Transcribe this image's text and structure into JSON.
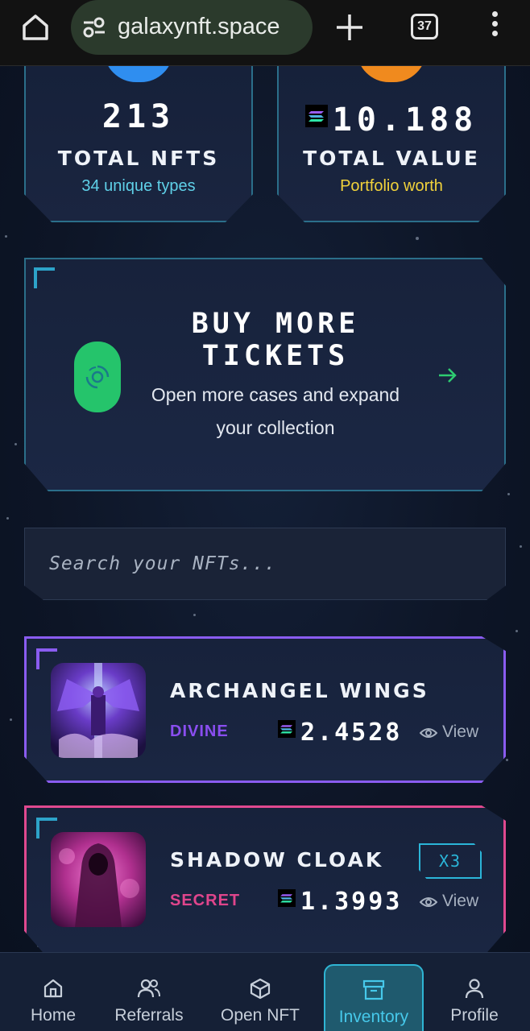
{
  "browser": {
    "url": "galaxynft.space",
    "tab_count": "37"
  },
  "stats": [
    {
      "value": "213",
      "label": "TOTAL NFTS",
      "sub": "34 unique types"
    },
    {
      "value": "10.188",
      "label": "TOTAL VALUE",
      "sub": "Portfolio worth",
      "currency_icon": "solana-icon"
    }
  ],
  "buy_banner": {
    "title": "BUY MORE TICKETS",
    "description": "Open more cases and expand your collection"
  },
  "search": {
    "placeholder": "Search your NFTs..."
  },
  "nfts": [
    {
      "name": "ARCHANGEL WINGS",
      "rarity": "DIVINE",
      "price": "2.4528",
      "view_label": "View",
      "rarity_color": "#8a4ef0"
    },
    {
      "name": "SHADOW CLOAK",
      "rarity": "SECRET",
      "price": "1.3993",
      "view_label": "View",
      "quantity": "X3",
      "rarity_color": "#e0458c"
    }
  ],
  "nav": [
    {
      "label": "Home",
      "icon": "home-icon"
    },
    {
      "label": "Referrals",
      "icon": "users-icon"
    },
    {
      "label": "Open NFT",
      "icon": "box-icon"
    },
    {
      "label": "Inventory",
      "icon": "archive-icon",
      "active": true
    },
    {
      "label": "Profile",
      "icon": "user-icon"
    }
  ]
}
